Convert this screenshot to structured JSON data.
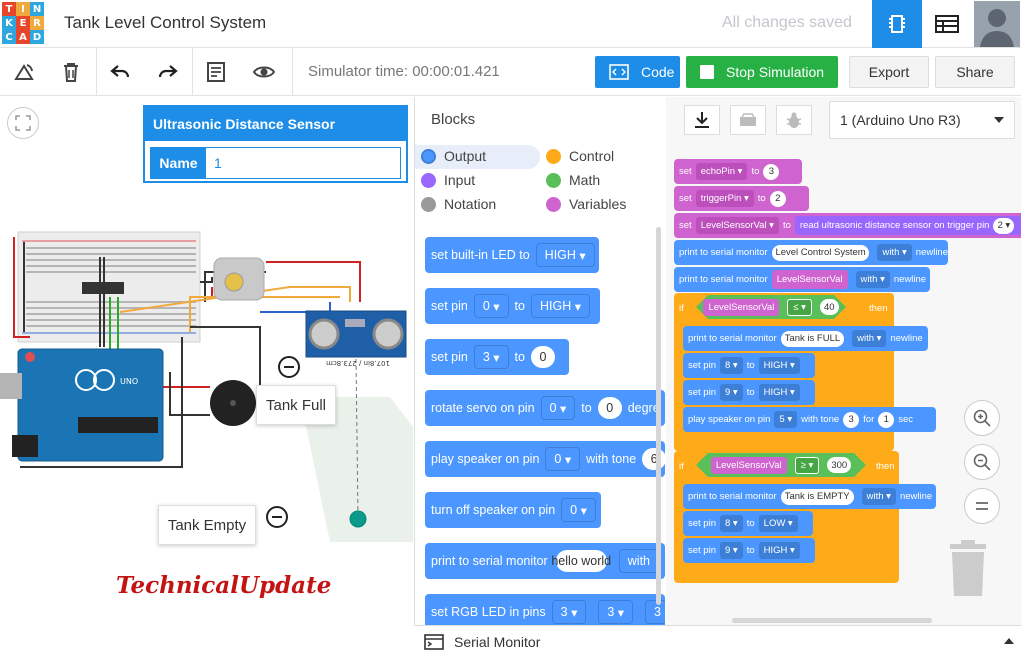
{
  "app": {
    "logo_letters": [
      "T",
      "I",
      "N",
      "K",
      "E",
      "R",
      "C",
      "A",
      "D"
    ],
    "title": "Tank Level Control System",
    "save_status": "All changes saved"
  },
  "toolbar": {
    "sim_time": "Simulator time: 00:00:01.421",
    "code_label": "Code",
    "stop_label": "Stop Simulation",
    "export_label": "Export",
    "share_label": "Share"
  },
  "inspector": {
    "title": "Ultrasonic Distance Sensor",
    "name_label": "Name",
    "name_value": "1"
  },
  "canvas": {
    "tooltip_full": "Tank Full",
    "tooltip_empty": "Tank Empty",
    "watermark": "TechnicalUpdate",
    "sensor_label": "107.8in / 273.8cm"
  },
  "blocks_panel": {
    "title": "Blocks",
    "categories": [
      {
        "label": "Output",
        "color": "#4c97ff"
      },
      {
        "label": "Control",
        "color": "#ffab19"
      },
      {
        "label": "Input",
        "color": "#9966ff"
      },
      {
        "label": "Math",
        "color": "#59c059"
      },
      {
        "label": "Notation",
        "color": "#999999"
      },
      {
        "label": "Variables",
        "color": "#cf63cf"
      }
    ],
    "palette": {
      "b1": {
        "text": "set built-in LED to",
        "opt": "HIGH"
      },
      "b2": {
        "text": "set pin",
        "pin": "0",
        "to": "to",
        "opt": "HIGH"
      },
      "b3": {
        "text": "set pin",
        "pin": "3",
        "to": "to",
        "val": "0"
      },
      "b4": {
        "text": "rotate servo on pin",
        "pin": "0",
        "to": "to",
        "val": "0",
        "more": "degre"
      },
      "b5": {
        "text": "play speaker on pin",
        "pin": "0",
        "with": "with tone",
        "val": "6"
      },
      "b6": {
        "text": "turn off speaker on pin",
        "pin": "0"
      },
      "b7": {
        "text": "print to serial monitor",
        "val": "hello world",
        "with": "with"
      },
      "b8": {
        "text": "set RGB LED in pins",
        "p1": "3",
        "p2": "3",
        "p3": "3"
      }
    }
  },
  "workspace": {
    "device": "1 (Arduino Uno R3)",
    "w_set": "set",
    "w_to": "to",
    "w_if": "if",
    "w_then": "then",
    "w_with": "with",
    "w_newline": "newline",
    "w_print": "print to serial monitor",
    "w_setpin": "set pin",
    "v_echo": "echoPin",
    "v_echo_val": "3",
    "v_trig": "triggerPin",
    "v_trig_val": "2",
    "v_level": "LevelSensorVal",
    "read_sensor": "read ultrasonic distance sensor on trigger pin",
    "read_pin": "2",
    "print_system": "Level Control System",
    "cond1_op": "≤",
    "cond1_val": "40",
    "print_full": "Tank is FULL",
    "pin8": "8",
    "pin9": "9",
    "high": "HIGH",
    "low": "LOW",
    "play_speaker": "play speaker on pin",
    "speaker_pin": "5",
    "with_tone": "with tone",
    "tone_val": "3",
    "for": "for",
    "dur_val": "1",
    "sec": "sec",
    "cond2_op": "≥",
    "cond2_val": "300",
    "print_empty": "Tank is EMPTY"
  },
  "serial": {
    "label": "Serial Monitor"
  }
}
